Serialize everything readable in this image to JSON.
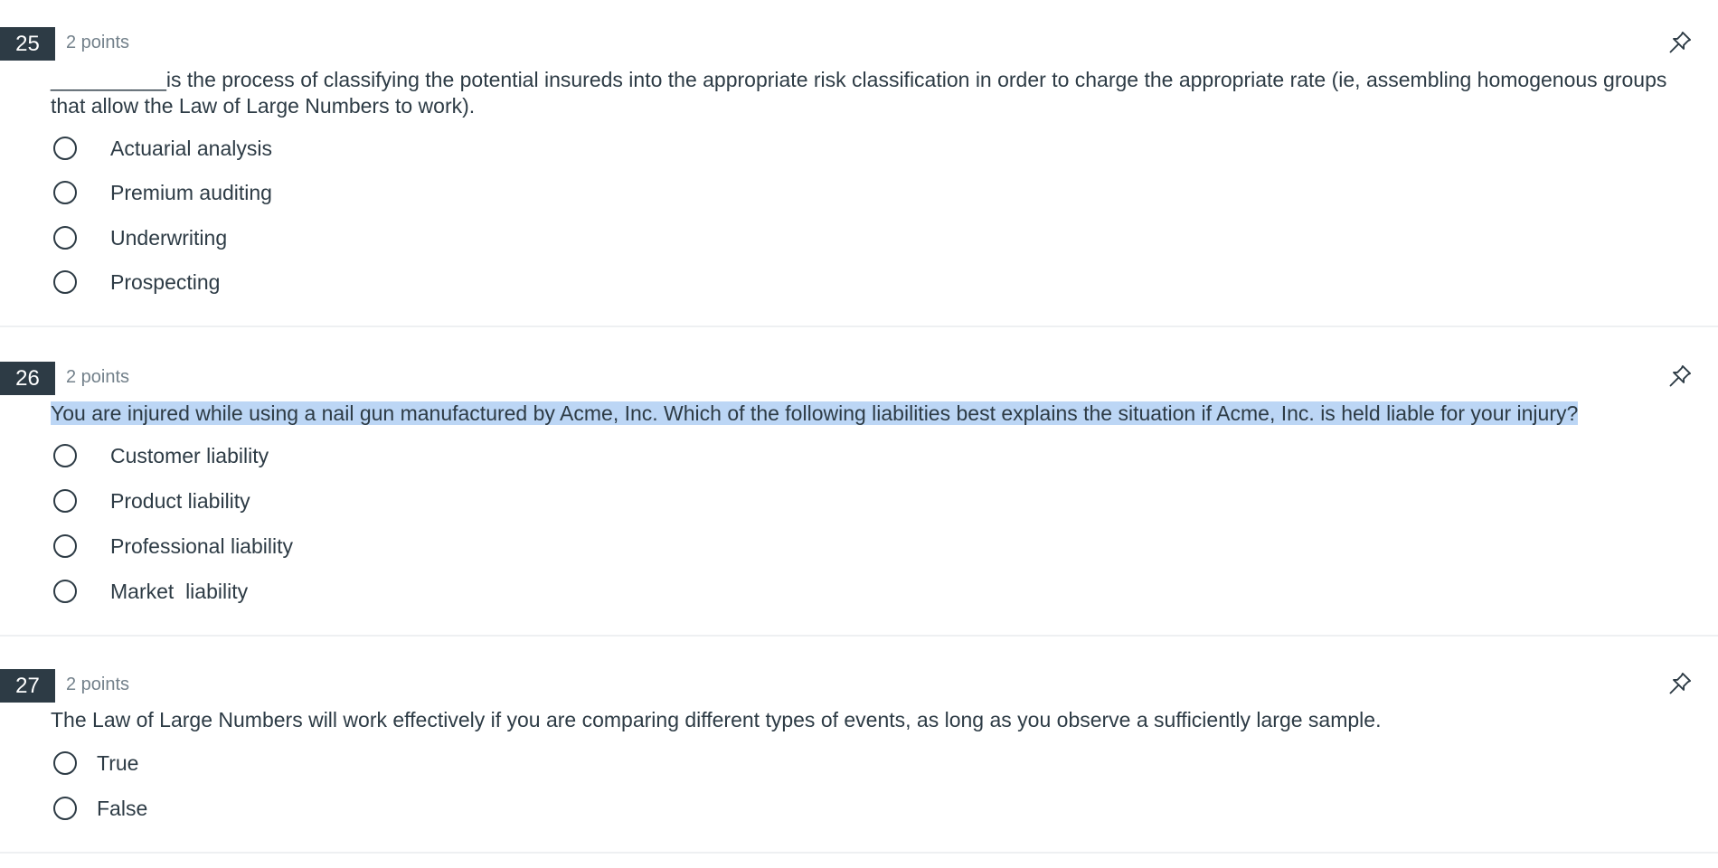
{
  "questions": [
    {
      "number": "25",
      "points": "2 points",
      "text": "__________is the process of classifying the potential insureds into the appropriate risk classification in order to charge the appropriate rate (ie, assembling homogenous groups that allow the Law of Large Numbers to work).",
      "options": [
        "Actuarial analysis",
        "Premium auditing",
        "Underwriting",
        "Prospecting"
      ]
    },
    {
      "number": "26",
      "points": "2 points",
      "text": "You are injured while using a nail gun manufactured by Acme, Inc.  Which of the following liabilities best explains the situation if Acme, Inc. is held liable for your injury?",
      "text_highlighted": true,
      "options": [
        "Customer liability",
        "Product liability",
        "Professional liability",
        "Market  liability"
      ]
    },
    {
      "number": "27",
      "points": "2 points",
      "text": "The Law of Large Numbers will work effectively if you are comparing different types of events, as long as you observe a sufficiently large sample.",
      "options": [
        "True",
        "False"
      ]
    }
  ],
  "icons": {
    "pin": "pin-icon",
    "radio": "radio-button"
  },
  "colors": {
    "number_badge_bg": "#2d3b45",
    "text": "#2d3b45",
    "points": "#73818b",
    "highlight": "#bcd6f5",
    "divider": "#eef0f2"
  }
}
